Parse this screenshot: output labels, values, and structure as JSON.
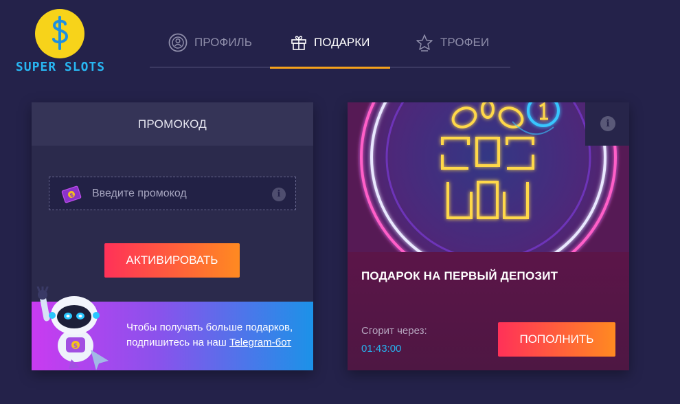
{
  "logo": {
    "text": "SUPER SLOTS",
    "icon": "dollar-coin-icon"
  },
  "tabs": [
    {
      "label": "ПРОФИЛЬ",
      "icon": "user-circle-icon",
      "active": false
    },
    {
      "label": "ПОДАРКИ",
      "icon": "gift-icon",
      "active": true
    },
    {
      "label": "ТРОФЕИ",
      "icon": "star-trophy-icon",
      "active": false
    }
  ],
  "promo": {
    "title": "ПРОМОКОД",
    "input_placeholder": "Введите промокод",
    "input_value": "",
    "info_symbol": "i",
    "activate_label": "АКТИВИРОВАТЬ",
    "telegram_text": "Чтобы получать больше подарков, подпишитесь на наш",
    "telegram_link": "Telegram-бот"
  },
  "gift": {
    "info_symbol": "i",
    "title": "ПОДАРОК НА ПЕРВЫЙ ДЕПОЗИТ",
    "expires_label": "Сгорит через:",
    "expires_time": "01:43:00",
    "deposit_label": "ПОПОЛНИТЬ"
  },
  "colors": {
    "background": "#24224a",
    "accent": "#f7a21b",
    "button_gradient_start": "#ff3158",
    "button_gradient_end": "#ff8a21",
    "timer": "#27b2ef",
    "logo_text": "#28b6f2"
  }
}
